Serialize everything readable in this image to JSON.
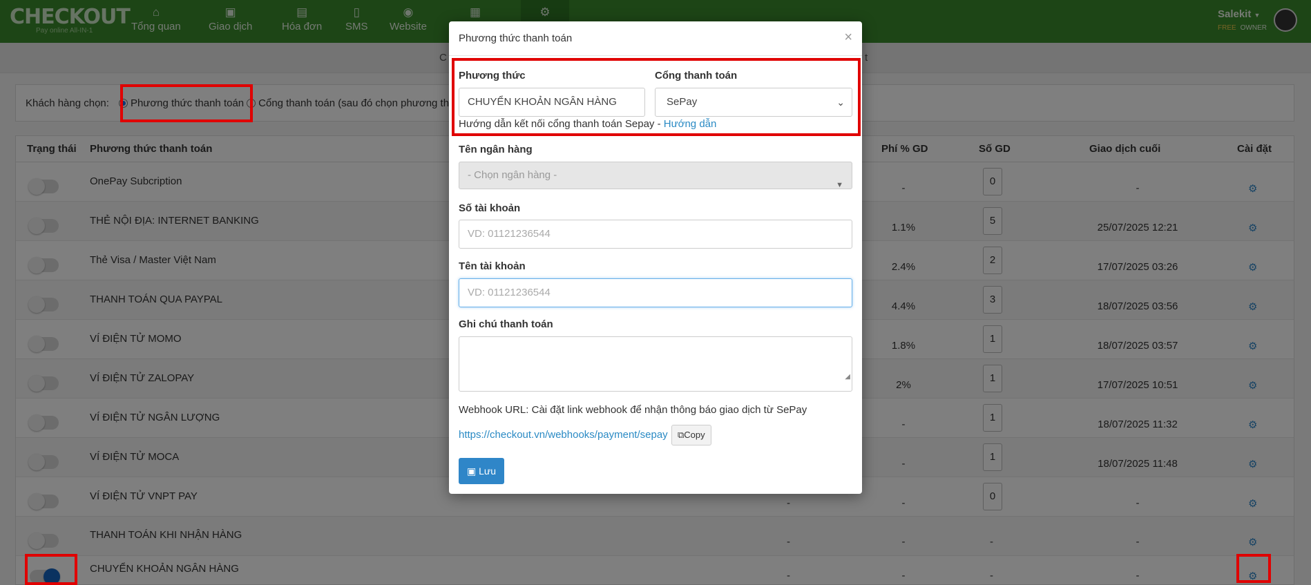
{
  "brand": {
    "name": "CHECKOUT",
    "tagline": "Pay online All-IN-1"
  },
  "nav": [
    {
      "label": "Tổng quan",
      "icon": "home-icon",
      "glyph": "⌂"
    },
    {
      "label": "Giao dịch",
      "icon": "money-icon",
      "glyph": "▣"
    },
    {
      "label": "Hóa đơn",
      "icon": "invoice-icon",
      "glyph": "▤"
    },
    {
      "label": "SMS",
      "icon": "phone-icon",
      "glyph": "▯"
    },
    {
      "label": "Website",
      "icon": "globe-icon",
      "glyph": "◉"
    },
    {
      "label": "",
      "icon": "report-icon",
      "glyph": "▦"
    },
    {
      "label": "",
      "icon": "settings-icon",
      "glyph": "⚙"
    }
  ],
  "user": {
    "name": "Salekit",
    "plan": "FREE",
    "role": "OWNER"
  },
  "subbar_text": "C",
  "subbar_text_right": "t",
  "choice": {
    "label": "Khách hàng chọn:",
    "option1": "Phương thức thanh toán",
    "option2": "Cổng thanh toán (sau đó chọn phương th"
  },
  "table": {
    "headers": {
      "status": "Trạng thái",
      "method": "Phương thức thanh toán",
      "fee": "Phí % GD",
      "count": "Số GD",
      "last": "Giao dịch cuối",
      "settings": "Cài đặt"
    },
    "rows": [
      {
        "name": "OnePay Subcription",
        "on": false,
        "col5": "",
        "fee": "-",
        "count": "0",
        "last": "-"
      },
      {
        "name": "THẺ NỘI ĐỊA: INTERNET BANKING",
        "on": false,
        "col5": "",
        "fee": "1.1%",
        "count": "5",
        "last": "25/07/2025 12:21"
      },
      {
        "name": "Thẻ Visa / Master Việt Nam",
        "on": false,
        "col5": "",
        "fee": "2.4%",
        "count": "2",
        "last": "17/07/2025 03:26"
      },
      {
        "name": "THANH TOÁN QUA PAYPAL",
        "on": false,
        "col5": "",
        "fee": "4.4%",
        "count": "3",
        "last": "18/07/2025 03:56"
      },
      {
        "name": "VÍ ĐIỆN TỬ MOMO",
        "on": false,
        "col5": "",
        "fee": "1.8%",
        "count": "1",
        "last": "18/07/2025 03:57"
      },
      {
        "name": "VÍ ĐIỆN TỬ ZALOPAY",
        "on": false,
        "col5": "",
        "fee": "2%",
        "count": "1",
        "last": "17/07/2025 10:51"
      },
      {
        "name": "VÍ ĐIỆN TỬ NGÂN LƯỢNG",
        "on": false,
        "col5": "",
        "fee": "-",
        "count": "1",
        "last": "18/07/2025 11:32"
      },
      {
        "name": "VÍ ĐIỆN TỬ MOCA",
        "on": false,
        "col5": "",
        "fee": "-",
        "count": "1",
        "last": "18/07/2025 11:48"
      },
      {
        "name": "VÍ ĐIỆN TỬ VNPT PAY",
        "on": false,
        "col5": "-",
        "fee": "-",
        "count": "0",
        "last": "-"
      },
      {
        "name": "THANH TOÁN KHI NHẬN HÀNG",
        "on": false,
        "col5": "-",
        "fee": "-",
        "count": "-",
        "last": "-"
      },
      {
        "name": "CHUYỂN KHOẢN NGÂN HÀNG",
        "on": true,
        "col5": "-",
        "fee": "-",
        "count": "-",
        "last": "-"
      }
    ]
  },
  "modal": {
    "title": "Phương thức thanh toán",
    "close": "×",
    "method_label": "Phương thức",
    "method_value": "CHUYỂN KHOẢN NGÂN HÀNG",
    "gateway_label": "Cổng thanh toán",
    "gateway_value": "SePay",
    "guide_text": "Hướng dẫn kết nối cổng thanh toán Sepay -",
    "guide_link": "Hướng dẫn",
    "bank_label": "Tên ngân hàng",
    "bank_placeholder": "- Chọn ngân hàng -",
    "account_no_label": "Số tài khoản",
    "account_no_placeholder": "VD: 01121236544",
    "account_name_label": "Tên tài khoản",
    "account_name_placeholder": "VD: 01121236544",
    "note_label": "Ghi chú thanh toán",
    "webhook_text": "Webhook URL: Cài đặt link webhook để nhận thông báo giao dịch từ SePay",
    "webhook_url": "https://checkout.vn/webhooks/payment/sepay",
    "copy_label": "Copy",
    "save_label": "Lưu"
  }
}
